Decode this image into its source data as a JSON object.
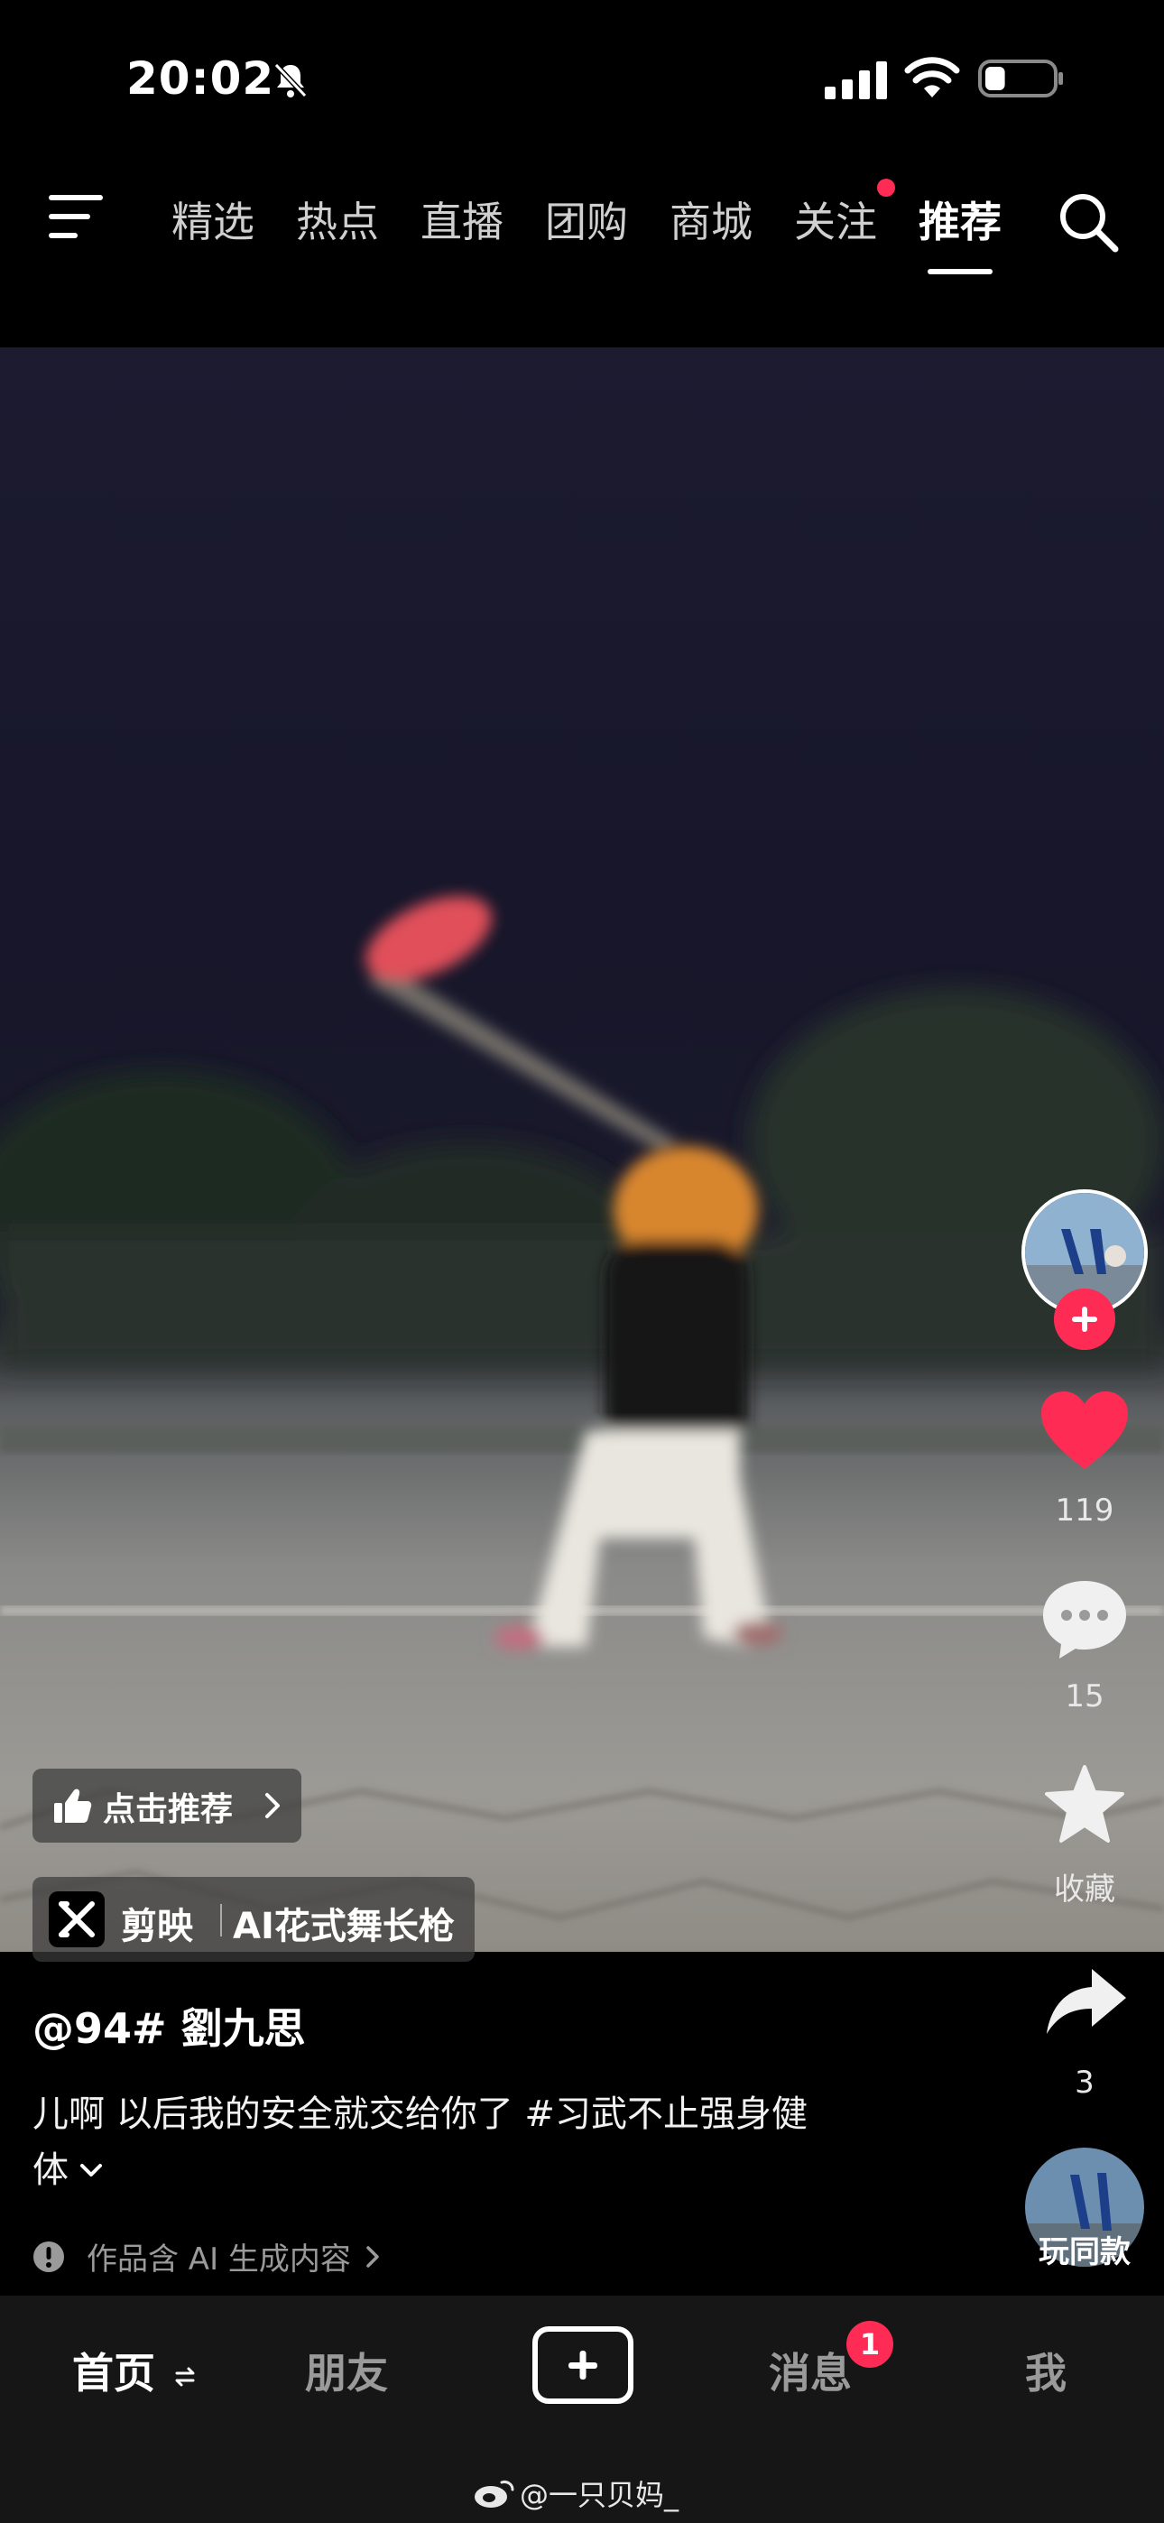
{
  "status_bar": {
    "time": "20:02",
    "battery_level": 0.3
  },
  "top_nav": {
    "tabs": [
      "精选",
      "热点",
      "直播",
      "团购",
      "商城",
      "关注",
      "推荐"
    ],
    "active_tab": "推荐",
    "follow_has_dot": true
  },
  "right_rail": {
    "likes": "119",
    "comments": "15",
    "favorite_label": "收藏",
    "shares": "3",
    "same_style_label": "玩同款"
  },
  "overlay": {
    "recommend_label": "点击推荐",
    "jianying_label": "剪映",
    "template_label": "AI花式舞长枪"
  },
  "post": {
    "author": "@94# 劉九思",
    "caption_line1": "儿啊  以后我的安全就交给你了 #习武不止强身健",
    "caption_line2": "体",
    "ai_note": "作品含 AI 生成内容"
  },
  "bottom_nav": {
    "home": "首页",
    "friends": "朋友",
    "messages": "消息",
    "messages_badge": "1",
    "me": "我"
  },
  "watermark": "@一只贝妈_",
  "colors": {
    "accent": "#fe2c55",
    "background": "#000000",
    "nav_bg": "#161616"
  }
}
